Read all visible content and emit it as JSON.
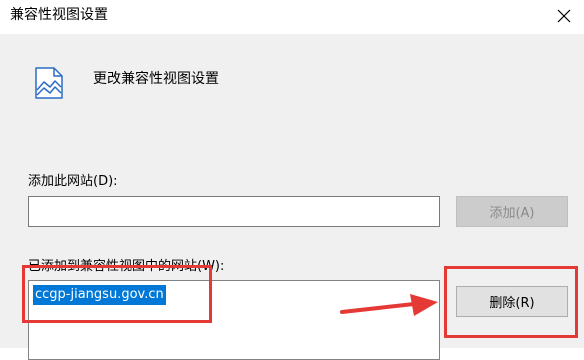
{
  "window": {
    "title": "兼容性视图设置",
    "close_glyph": "✕"
  },
  "header": {
    "icon": "compat-view-icon",
    "text": "更改兼容性视图设置"
  },
  "add_section": {
    "label": "添加此网站(D):",
    "input_value": "",
    "add_button_label": "添加(A)"
  },
  "list_section": {
    "label": "已添加到兼容性视图中的网站(W):",
    "items": [
      "ccgp-jiangsu.gov.cn"
    ],
    "remove_button_label": "删除(R)"
  },
  "annotations": {
    "highlight_color": "#e53935",
    "arrow_color": "#e53935"
  },
  "colors": {
    "selection": "#0078d7",
    "dialog_background": "#f0f0f0"
  }
}
